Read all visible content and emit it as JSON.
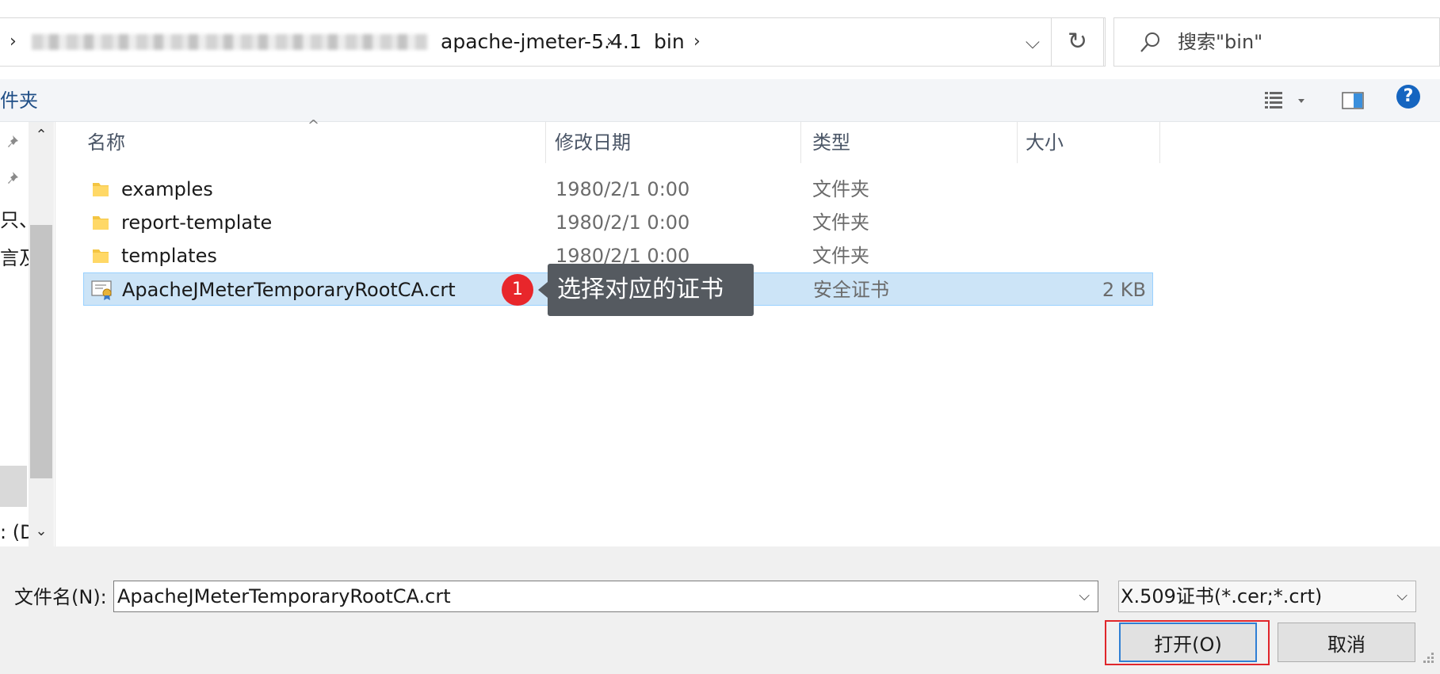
{
  "address": {
    "crumbs": [
      "apache-jmeter-5.4.1",
      "bin"
    ],
    "separator": "›"
  },
  "search": {
    "placeholder": "搜索\"bin\""
  },
  "toolbar": {
    "new_folder_label": "件夹"
  },
  "nav": {
    "items": [
      "只、",
      "言及",
      ": (D"
    ]
  },
  "columns": {
    "name": "名称",
    "date": "修改日期",
    "type": "类型",
    "size": "大小"
  },
  "files": [
    {
      "name": "examples",
      "date": "1980/2/1 0:00",
      "type": "文件夹",
      "size": "",
      "icon": "folder-icon"
    },
    {
      "name": "report-template",
      "date": "1980/2/1 0:00",
      "type": "文件夹",
      "size": "",
      "icon": "folder-icon"
    },
    {
      "name": "templates",
      "date": "1980/2/1 0:00",
      "type": "文件夹",
      "size": "",
      "icon": "folder-icon"
    },
    {
      "name": "ApacheJMeterTemporaryRootCA.crt",
      "date": "",
      "type": "安全证书",
      "size": "2 KB",
      "icon": "certificate-icon",
      "selected": true
    }
  ],
  "annotation": {
    "badge": "1",
    "text": "选择对应的证书"
  },
  "bottom": {
    "filename_label": "文件名(N):",
    "filename_value": "ApacheJMeterTemporaryRootCA.crt",
    "filetype_value": "X.509证书(*.cer;*.crt)",
    "open_label": "打开(O)",
    "cancel_label": "取消"
  },
  "colors": {
    "selection": "#cce4f7",
    "accent": "#2f7fd4",
    "highlight": "#e0262b",
    "help": "#1565c0"
  }
}
